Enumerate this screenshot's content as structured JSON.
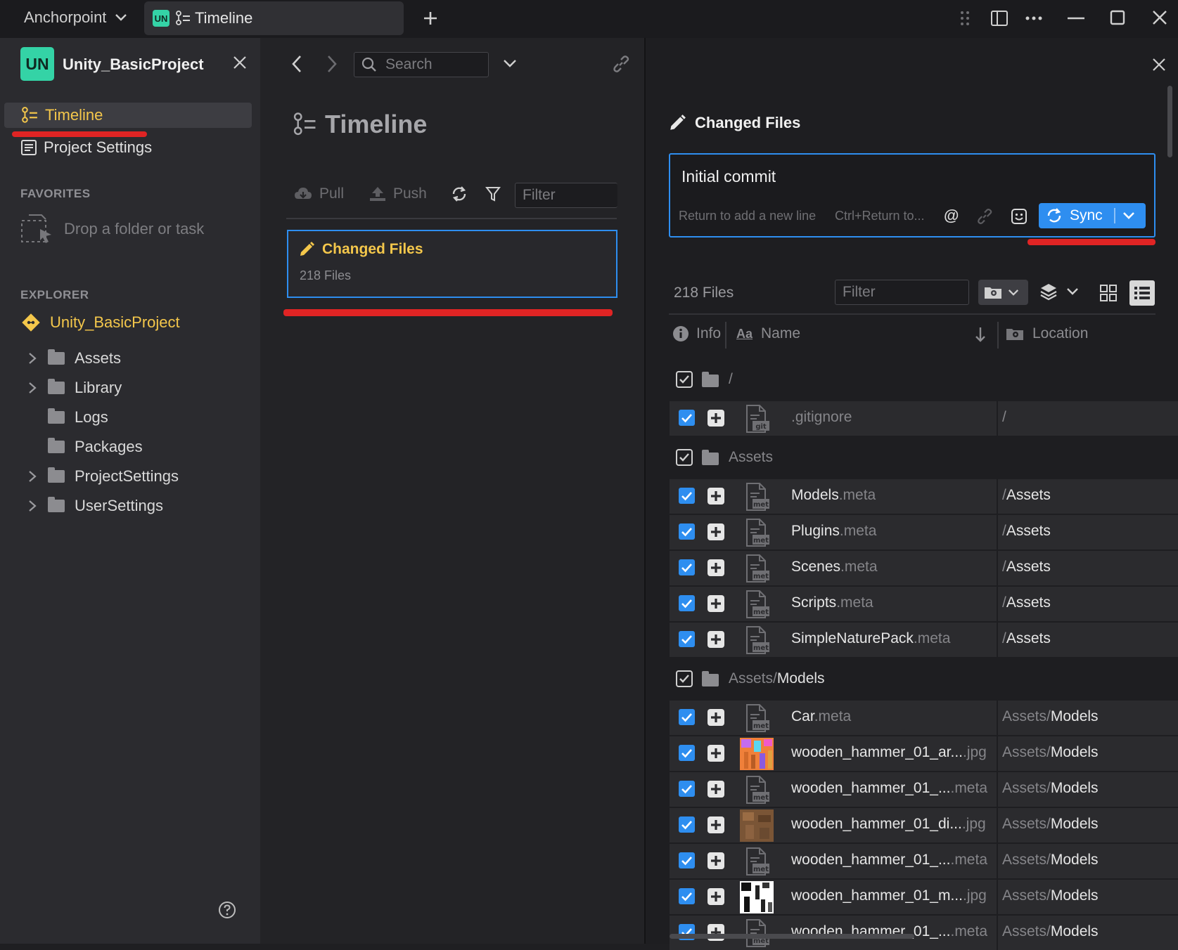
{
  "titlebar": {
    "app_name": "Anchorpoint",
    "tab_badge": "UN",
    "tab_label": "Timeline"
  },
  "sidebar": {
    "project_badge": "UN",
    "project_name": "Unity_BasicProject",
    "nav": [
      {
        "label": "Timeline",
        "active": true
      },
      {
        "label": "Project Settings",
        "active": false
      }
    ],
    "favorites_header": "FAVORITES",
    "favorites_drop": "Drop a folder or task",
    "explorer_header": "EXPLORER",
    "explorer_root": "Unity_BasicProject",
    "tree": [
      {
        "label": "Assets",
        "expandable": true
      },
      {
        "label": "Library",
        "expandable": true
      },
      {
        "label": "Logs",
        "expandable": false
      },
      {
        "label": "Packages",
        "expandable": false
      },
      {
        "label": "ProjectSettings",
        "expandable": true
      },
      {
        "label": "UserSettings",
        "expandable": true
      }
    ]
  },
  "middle": {
    "search_placeholder": "Search",
    "title": "Timeline",
    "pull_label": "Pull",
    "push_label": "Push",
    "filter_placeholder": "Filter",
    "card_title": "Changed Files",
    "card_subtitle": "218 Files"
  },
  "right": {
    "header_title": "Changed Files",
    "commit_message": "Initial commit",
    "hint_newline": "Return to add a new line",
    "hint_commit": "Ctrl+Return to...",
    "mention_symbol": "@",
    "sync_label": "Sync",
    "file_count": "218 Files",
    "filter_placeholder": "Filter",
    "col_info": "Info",
    "col_name_prefix": "Aa",
    "col_name": "Name",
    "col_location": "Location",
    "groups": [
      {
        "path_dim": "",
        "path": "/",
        "files": [
          {
            "name": "",
            "ext": ".gitignore",
            "icon": "git",
            "loc_dim": "",
            "loc": "/",
            "loc_all_dim": true
          }
        ]
      },
      {
        "path_dim": "",
        "path": "Assets",
        "files": [
          {
            "name": "Models",
            "ext": ".meta",
            "icon": "meta",
            "loc_dim": "/",
            "loc": "Assets"
          },
          {
            "name": "Plugins",
            "ext": ".meta",
            "icon": "meta",
            "loc_dim": "/",
            "loc": "Assets"
          },
          {
            "name": "Scenes",
            "ext": ".meta",
            "icon": "meta",
            "loc_dim": "/",
            "loc": "Assets"
          },
          {
            "name": "Scripts",
            "ext": ".meta",
            "icon": "meta",
            "loc_dim": "/",
            "loc": "Assets"
          },
          {
            "name": "SimpleNaturePack",
            "ext": ".meta",
            "icon": "meta",
            "loc_dim": "/",
            "loc": "Assets"
          }
        ]
      },
      {
        "path_dim": "Assets/",
        "path": "Models",
        "files": [
          {
            "name": "Car",
            "ext": ".meta",
            "icon": "meta",
            "loc_dim": "Assets/",
            "loc": "Models"
          },
          {
            "name": "wooden_hammer_01_ar...",
            "ext": ".jpg",
            "icon": "thumb-color",
            "loc_dim": "Assets/",
            "loc": "Models"
          },
          {
            "name": "wooden_hammer_01_...",
            "ext": ".meta",
            "icon": "meta",
            "loc_dim": "Assets/",
            "loc": "Models"
          },
          {
            "name": "wooden_hammer_01_di...",
            "ext": ".jpg",
            "icon": "thumb-wood",
            "loc_dim": "Assets/",
            "loc": "Models"
          },
          {
            "name": "wooden_hammer_01_...",
            "ext": ".meta",
            "icon": "meta",
            "loc_dim": "Assets/",
            "loc": "Models"
          },
          {
            "name": "wooden_hammer_01_m...",
            "ext": ".jpg",
            "icon": "thumb-mask",
            "loc_dim": "Assets/",
            "loc": "Models"
          },
          {
            "name": "wooden_hammer_01_...",
            "ext": ".meta",
            "icon": "meta",
            "loc_dim": "Assets/",
            "loc": "Models"
          }
        ]
      }
    ]
  },
  "colors": {
    "accent_yellow": "#f4c74b",
    "accent_blue": "#2e8ef0",
    "badge_green": "#34d3a6",
    "annotation_red": "#e02424"
  }
}
